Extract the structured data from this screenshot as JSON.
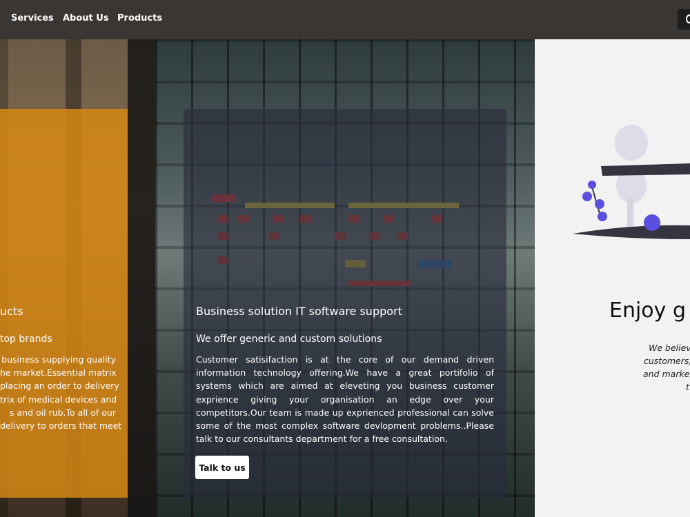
{
  "nav": {
    "items": [
      {
        "label": "Services"
      },
      {
        "label": "About Us"
      },
      {
        "label": "Products"
      }
    ]
  },
  "left_card": {
    "title": "ucts",
    "subtitle": "top brands",
    "body_lines": [
      "business supplying quality",
      "he market.Essential matrix",
      "placing an order to delivery",
      "trix of medical devices and",
      "s and oil rub.To all of our",
      "delivery to orders that meet"
    ]
  },
  "middle_card": {
    "title": "Business solution IT software support",
    "subtitle": "We offer generic and custom solutions",
    "body": "Customer satisifaction is at the core of our demand driven information technology offering.We have a great portifolio of systems which are aimed at eleveting you business customer exprience giving your organisation an edge over your competitors.Our team is made up exprienced professional can solve some of the most complex software devlopment problems..Please talk to our consultants department for a free consultation.",
    "button_label": "Talk to us"
  },
  "right_card": {
    "title": "Enjoy g",
    "lines": [
      "We believe",
      "customers,",
      "and marke",
      "t"
    ]
  },
  "colors": {
    "nav_bg": "#3a3634",
    "orange_card": "#d68714",
    "dark_card": "#282c3c",
    "illustration_accent": "#5b4fe0"
  },
  "icons": {
    "nav_cta": "user-icon"
  }
}
